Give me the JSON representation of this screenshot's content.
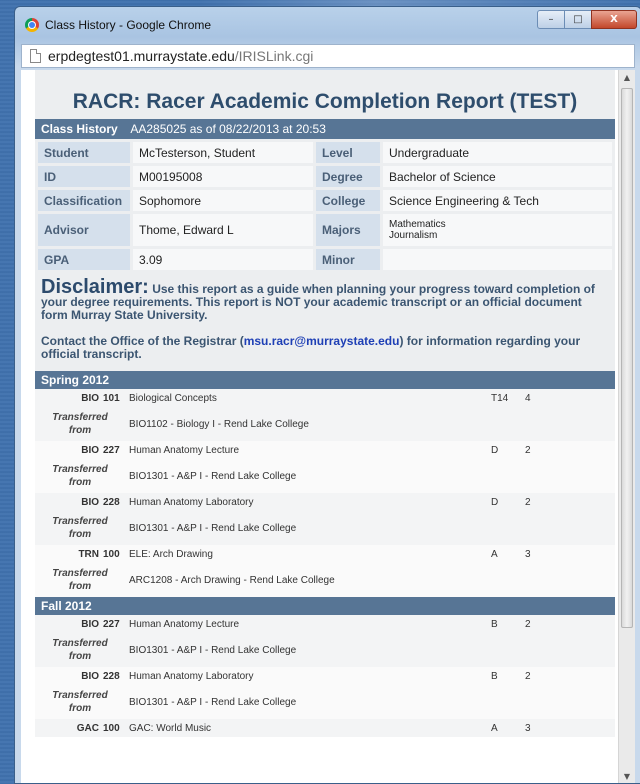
{
  "window": {
    "title": "Class History - Google Chrome",
    "url_host": "erpdegtest01.murraystate.edu",
    "url_path": "/IRISLink.cgi",
    "minimize": "–",
    "maximize": "□",
    "close": "X"
  },
  "report": {
    "title": "RACR: Racer Academic Completion Report (TEST)",
    "section_label": "Class History",
    "section_info": "AA285025 as of 08/22/2013 at 20:53"
  },
  "student": {
    "labels": {
      "student": "Student",
      "level": "Level",
      "id": "ID",
      "degree": "Degree",
      "classification": "Classification",
      "college": "College",
      "advisor": "Advisor",
      "majors": "Majors",
      "gpa": "GPA",
      "minor": "Minor"
    },
    "student": "McTesterson, Student",
    "level": "Undergraduate",
    "id": "M00195008",
    "degree": "Bachelor of Science",
    "classification": "Sophomore",
    "college": "Science Engineering & Tech",
    "advisor": "Thome, Edward L",
    "majors": [
      "Mathematics",
      "Journalism"
    ],
    "gpa": "3.09",
    "minor": ""
  },
  "disclaimer": {
    "heading": "Disclaimer:",
    "lead": "Use this report as a guide when planning your progress toward",
    "body": "completion of your degree requirements. This report is NOT your academic transcript or an official document form Murray State University.",
    "contact_pre": "Contact the Office of the Registrar (",
    "email": "msu.racr@murraystate.edu",
    "contact_post": ") for information regarding your official transcript."
  },
  "transferred_from_label": [
    "Transferred",
    "from"
  ],
  "terms": [
    {
      "name": "Spring 2012",
      "courses": [
        {
          "subject": "BIO",
          "number": "101",
          "title": "Biological Concepts",
          "grade": "T14",
          "credits": "4",
          "transfer": "BIO1102 - Biology I - Rend Lake College"
        },
        {
          "subject": "BIO",
          "number": "227",
          "title": "Human Anatomy Lecture",
          "grade": "D",
          "credits": "2",
          "transfer": "BIO1301 - A&P I - Rend Lake College"
        },
        {
          "subject": "BIO",
          "number": "228",
          "title": "Human Anatomy Laboratory",
          "grade": "D",
          "credits": "2",
          "transfer": "BIO1301 - A&P I - Rend Lake College"
        },
        {
          "subject": "TRN",
          "number": "100",
          "title": "ELE: Arch Drawing",
          "grade": "A",
          "credits": "3",
          "transfer": "ARC1208 - Arch Drawing - Rend Lake College"
        }
      ]
    },
    {
      "name": "Fall 2012",
      "courses": [
        {
          "subject": "BIO",
          "number": "227",
          "title": "Human Anatomy Lecture",
          "grade": "B",
          "credits": "2",
          "transfer": "BIO1301 - A&P I - Rend Lake College"
        },
        {
          "subject": "BIO",
          "number": "228",
          "title": "Human Anatomy Laboratory",
          "grade": "B",
          "credits": "2",
          "transfer": "BIO1301 - A&P I - Rend Lake College"
        },
        {
          "subject": "GAC",
          "number": "100",
          "title": "GAC: World Music",
          "grade": "A",
          "credits": "3",
          "transfer": null
        }
      ]
    }
  ]
}
